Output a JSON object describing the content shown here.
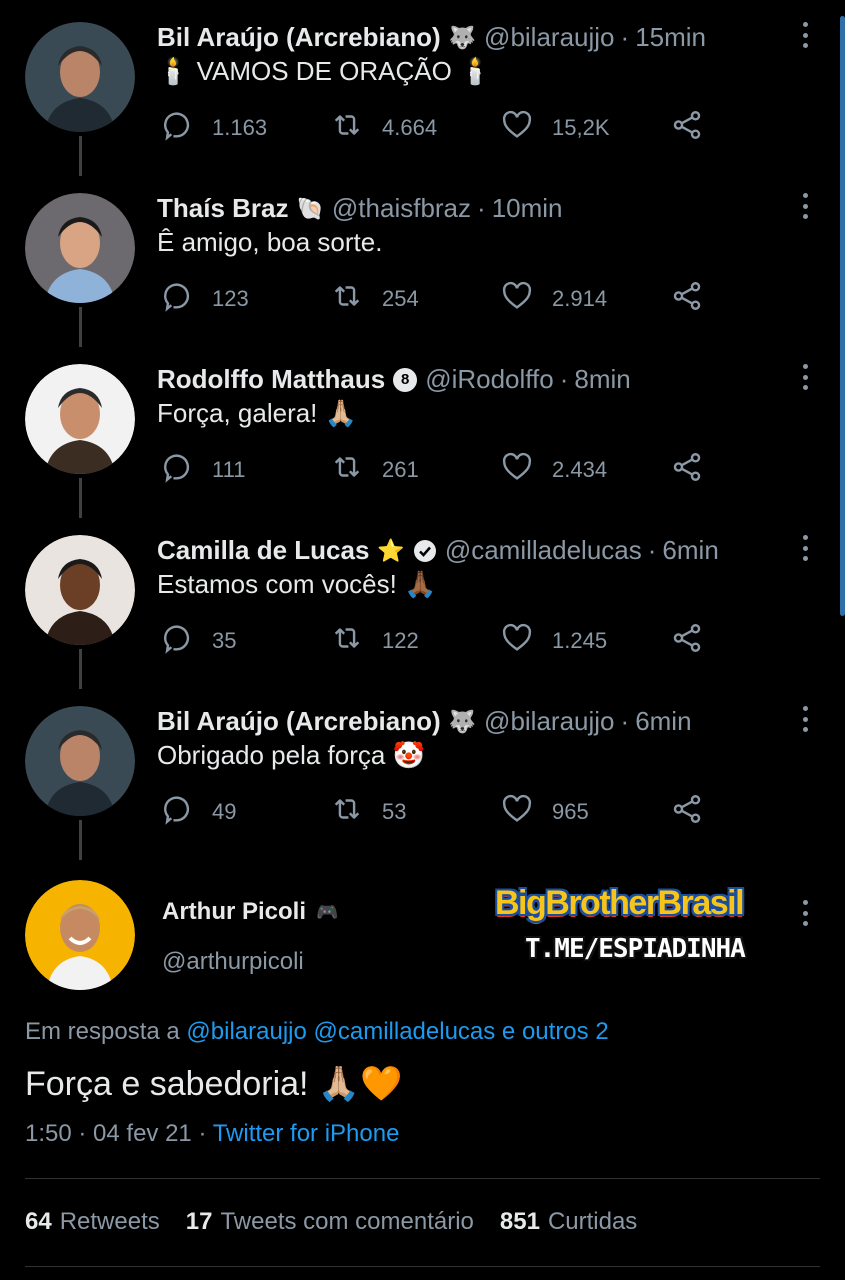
{
  "tweets": [
    {
      "name": "Bil Araújo (Arcrebiano)",
      "badge": "🐺",
      "handle": "@bilaraujjo",
      "time": "15min",
      "text": "🕯️ VAMOS DE ORAÇÃO 🕯️",
      "replies": "1.163",
      "retweets": "4.664",
      "likes": "15,2K",
      "avatar_icon": "man-avatar"
    },
    {
      "name": "Thaís Braz",
      "badge": "🐚",
      "handle": "@thaisfbraz",
      "time": "10min",
      "text": "Ê amigo, boa sorte.",
      "replies": "123",
      "retweets": "254",
      "likes": "2.914",
      "avatar_icon": "woman-avatar"
    },
    {
      "name": "Rodolffo Matthaus",
      "badge": "8",
      "handle": "@iRodolffo",
      "time": "8min",
      "text": "Força, galera! 🙏🏼",
      "replies": "111",
      "retweets": "261",
      "likes": "2.434",
      "avatar_icon": "man-avatar"
    },
    {
      "name": "Camilla de Lucas",
      "badge": "⭐",
      "handle": "@camilladelucas",
      "time": "6min",
      "text": "Estamos com vocês! 🙏🏾",
      "replies": "35",
      "retweets": "122",
      "likes": "1.245",
      "avatar_icon": "woman-avatar"
    },
    {
      "name": "Bil Araújo (Arcrebiano)",
      "badge": "🐺",
      "handle": "@bilaraujjo",
      "time": "6min",
      "text": "Obrigado pela força 🤡",
      "replies": "49",
      "retweets": "53",
      "likes": "965",
      "avatar_icon": "man-avatar"
    }
  ],
  "main_tweet": {
    "name": "Arthur Picoli",
    "badge": "🎮",
    "handle": "@arthurpicoli",
    "reply_prefix": "Em resposta a",
    "reply_mentions": "@bilaraujjo @camilladelucas e outros 2",
    "text": "Força e sabedoria! 🙏🏼🧡",
    "timestamp": "1:50 · 04 fev 21 ·",
    "source": "Twitter for iPhone",
    "retweets_count": "64",
    "retweets_label": "Retweets",
    "quotes_count": "17",
    "quotes_label": "Tweets com comentário",
    "likes_count": "851",
    "likes_label": "Curtidas"
  },
  "watermark": {
    "title": "BigBrotherBrasil",
    "subtitle": "T.ME/ESPIADINHA"
  },
  "colors": {
    "background": "#000000",
    "text": "#e7e9ea",
    "muted": "#8b98a5",
    "link": "#1d9bf0"
  }
}
